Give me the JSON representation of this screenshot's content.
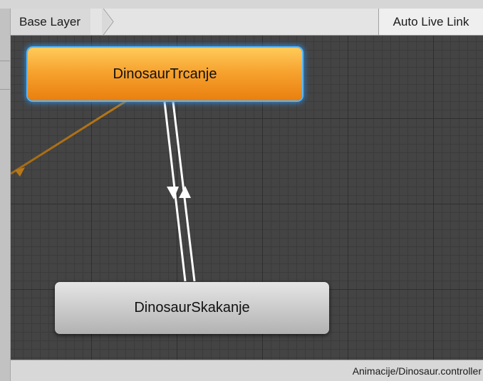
{
  "toolbar": {
    "breadcrumb_label": "Base Layer",
    "live_link_label": "Auto Live Link"
  },
  "graph": {
    "nodes": [
      {
        "label": "DinosaurTrcanje",
        "state": "default",
        "color": "#f29420"
      },
      {
        "label": "DinosaurSkakanje",
        "state": "normal",
        "color": "#c4c4c4"
      }
    ],
    "transition_colors": {
      "entry": "#b87818",
      "transition": "#ffffff"
    }
  },
  "statusbar": {
    "asset_path": "Animacije/Dinosaur.controller"
  },
  "colors": {
    "graph_background": "#444444",
    "selection_glow": "#3ea2ff"
  }
}
